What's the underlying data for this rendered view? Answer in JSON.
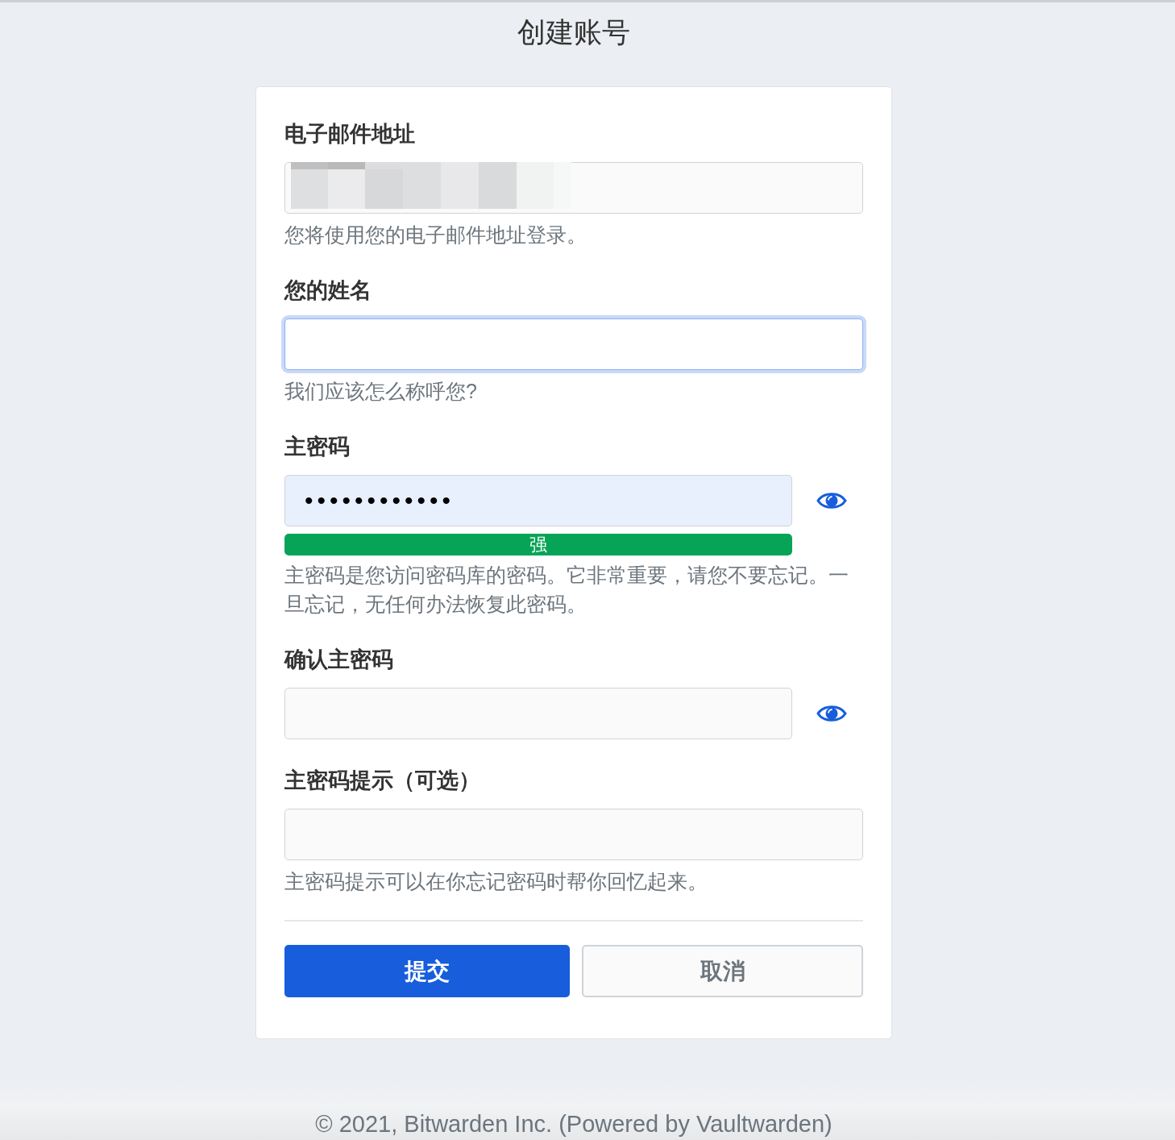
{
  "page": {
    "title": "创建账号"
  },
  "form": {
    "fields": [
      {
        "kind": "email",
        "label": "电子邮件地址",
        "value_obscured": true,
        "focused": false,
        "autofilled": false,
        "help": "您将使用您的电子邮件地址登录。"
      },
      {
        "kind": "text",
        "label": "您的姓名",
        "focused": true,
        "autofilled": false,
        "help": "我们应该怎么称呼您?"
      },
      {
        "kind": "password",
        "label": "主密码",
        "value": "••••••••••••",
        "focused": false,
        "autofilled": true,
        "strength": {
          "level": 1,
          "label": "强"
        },
        "help": "主密码是您访问密码库的密码。它非常重要，请您不要忘记。一旦忘记，无任何办法恢复此密码。"
      },
      {
        "kind": "password",
        "label": "确认主密码",
        "focused": false,
        "autofilled": false
      },
      {
        "kind": "text",
        "label": "主密码提示（可选）",
        "focused": false,
        "autofilled": false,
        "help": "主密码提示可以在你忘记密码时帮你回忆起来。"
      }
    ]
  },
  "buttons": [
    {
      "kind": "primary",
      "label": "提交"
    },
    {
      "kind": "secondary",
      "label": "取消"
    }
  ],
  "footer": "© 2021, Bitwarden Inc. (Powered by Vaultwarden)"
}
